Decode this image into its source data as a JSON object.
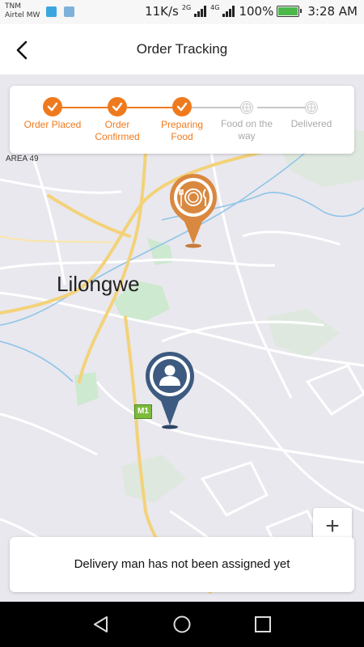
{
  "status_bar": {
    "carrier_1": "TNM",
    "carrier_2": "Airtel MW",
    "speed": "11K/s",
    "net_1": "2G",
    "net_2": "4G",
    "battery": "100%",
    "time": "3:28 AM"
  },
  "header": {
    "title": "Order Tracking",
    "back_icon": "arrow-left-icon"
  },
  "progress": {
    "accent": "#ef7a1e",
    "steps": [
      {
        "label": "Order Placed",
        "state": "done"
      },
      {
        "label": "Order\nConfirmed",
        "state": "done"
      },
      {
        "label": "Preparing\nFood",
        "state": "done"
      },
      {
        "label": "Food on the\nway",
        "state": "pending"
      },
      {
        "label": "Delivered",
        "state": "pending"
      }
    ]
  },
  "map": {
    "city_label": "Lilongwe",
    "area_label": "AREA 49",
    "road_shield": "M1",
    "restaurant_marker": {
      "icon": "plate-cutlery-icon",
      "color": "#d9883f"
    },
    "driver_marker": {
      "icon": "user-icon",
      "color": "#3d5a80"
    },
    "zoom_in": "+"
  },
  "message": {
    "text": "Delivery man has not been assigned yet"
  },
  "nav": {
    "back": "triangle-back-icon",
    "home": "circle-home-icon",
    "recents": "square-recents-icon"
  }
}
